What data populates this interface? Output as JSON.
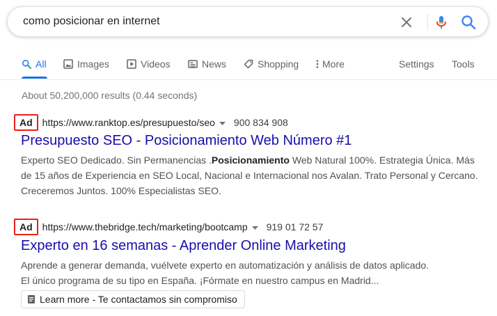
{
  "search": {
    "query": "como posicionar en internet",
    "clear_icon": "close-icon",
    "mic_icon": "microphone-icon",
    "search_icon": "search-icon"
  },
  "tabs": [
    {
      "label": "All",
      "icon": "search-icon",
      "active": true
    },
    {
      "label": "Images",
      "icon": "image-icon"
    },
    {
      "label": "Videos",
      "icon": "play-icon"
    },
    {
      "label": "News",
      "icon": "news-icon"
    },
    {
      "label": "Shopping",
      "icon": "tag-icon"
    },
    {
      "label": "More",
      "icon": "more-vert-icon"
    }
  ],
  "tools": {
    "settings": "Settings",
    "tools": "Tools"
  },
  "stats": "About 50,200,000 results (0.44 seconds)",
  "results": [
    {
      "badge": "Ad",
      "url": "https://www.ranktop.es/presupuesto/seo",
      "phone": "900 834 908",
      "title": "Presupuesto SEO - Posicionamiento Web Número #1",
      "desc_pre": "Experto SEO Dedicado. Sin Permanencias .",
      "desc_bold": "Posicionamiento",
      "desc_post": " Web Natural 100%. Estrategia Única. Más de 15 años de Experiencia en SEO Local, Nacional e Internacional nos Avalan. Trato Personal y Cercano. Creceremos Juntos. 100% Especialistas SEO."
    },
    {
      "badge": "Ad",
      "url": "https://www.thebridge.tech/marketing/bootcamp",
      "phone": "919 01 72 57",
      "title": "Experto en 16 semanas - Aprender Online Marketing",
      "desc_line1": "Aprende a generar demanda, vuélvete experto en automatización y análisis de datos aplicado.",
      "desc_line2": "El único programa de su tipo en España. ¡Fórmate en nuestro campus en Madrid...",
      "sitelink": "Learn more - Te contactamos sin compromiso",
      "sitelink_icon": "form-icon"
    }
  ],
  "colors": {
    "link": "#1a0dab",
    "accent": "#1a73e8",
    "ad_highlight": "#e8201a",
    "muted": "#70757a"
  }
}
